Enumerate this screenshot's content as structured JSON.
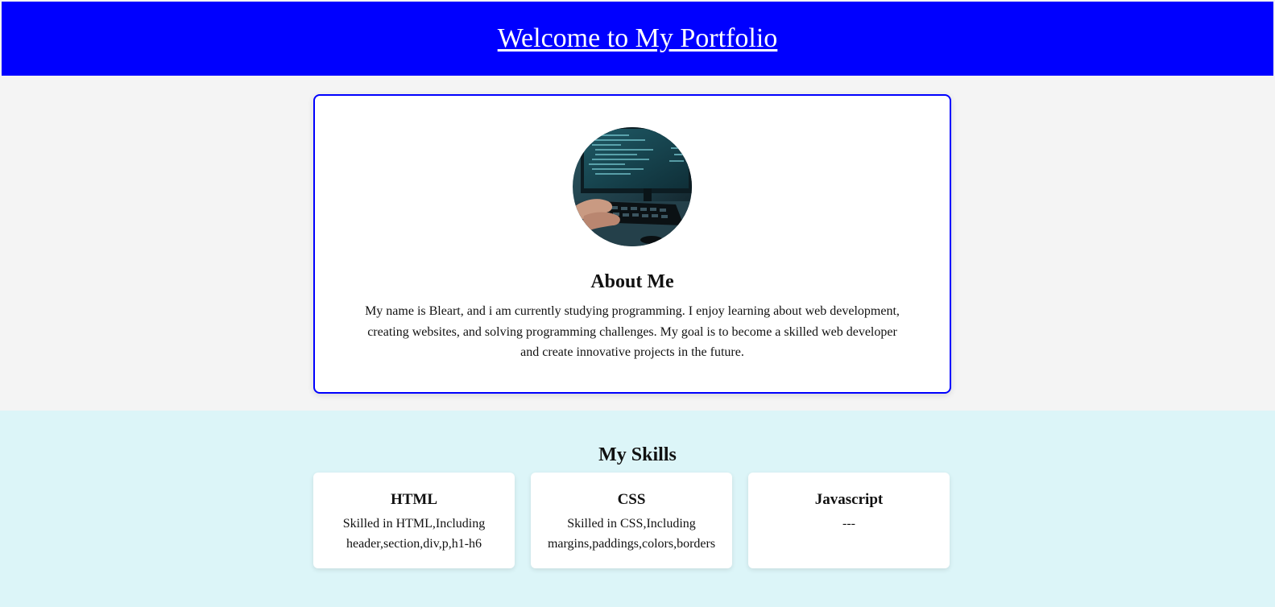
{
  "header": {
    "title": "Welcome to My Portfolio",
    "bg_color": "#0000ff"
  },
  "about": {
    "image_icon": "avatar-photo",
    "title": "About Me",
    "text": "My name is Bleart, and i am currently studying programming. I enjoy learning about web development, creating websites, and solving programming challenges. My goal is to become a skilled web developer and create innovative projects in the future."
  },
  "skills": {
    "title": "My Skills",
    "bg_color": "#dcf5f8",
    "items": [
      {
        "name": "HTML",
        "description": "Skilled in HTML,Including header,section,div,p,h1-h6"
      },
      {
        "name": "CSS",
        "description": "Skilled in CSS,Including margins,paddings,colors,borders"
      },
      {
        "name": "Javascript",
        "description": "---"
      }
    ]
  }
}
